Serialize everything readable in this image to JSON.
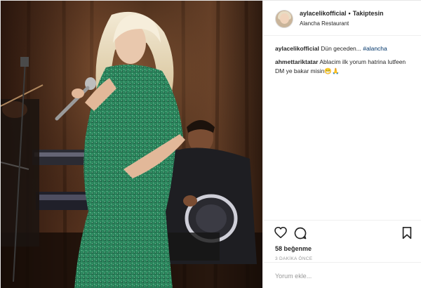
{
  "header": {
    "username": "aylacelikofficial",
    "separator": "•",
    "follow_label": "Takiptesin",
    "location": "Alancha Restaurant"
  },
  "comments": [
    {
      "user": "aylacelikofficial",
      "text": "Dün geceden...",
      "hashtag": "#alancha"
    },
    {
      "user": "ahmettariktatar",
      "text": "Ablacim ilk yorum hatrina lutfeen DM ye bakar misin😁🙏"
    }
  ],
  "actions": {
    "like_icon": "heart-icon",
    "comment_icon": "comment-icon",
    "save_icon": "bookmark-icon",
    "likes": "58 beğenme",
    "timestamp": "3 DAKİKA ÖNCE"
  },
  "add_comment": {
    "placeholder": "Yorum ekle..."
  },
  "colors": {
    "text": "#262626",
    "muted": "#999999",
    "hashtag": "#003569",
    "border": "#efefef",
    "dress_green": "#2f8f63"
  }
}
